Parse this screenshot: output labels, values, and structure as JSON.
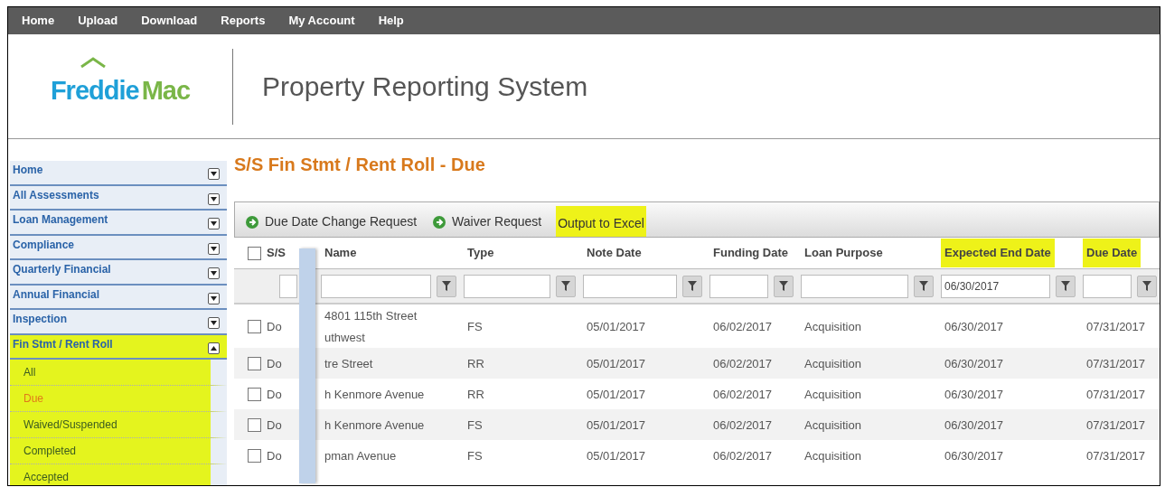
{
  "top_nav": [
    "Home",
    "Upload",
    "Download",
    "Reports",
    "My Account",
    "Help"
  ],
  "logo": {
    "part_1": "Freddie",
    "part_2": "Mac"
  },
  "app_title": "Property Reporting System",
  "sidebar": {
    "items": [
      {
        "label": "Home",
        "expanded": false,
        "highlighted": false
      },
      {
        "label": "All Assessments",
        "expanded": false,
        "highlighted": false
      },
      {
        "label": "Loan Management",
        "expanded": false,
        "highlighted": false
      },
      {
        "label": "Compliance",
        "expanded": false,
        "highlighted": false
      },
      {
        "label": "Quarterly Financial",
        "expanded": false,
        "highlighted": false
      },
      {
        "label": "Annual Financial",
        "expanded": false,
        "highlighted": false
      },
      {
        "label": "Inspection",
        "expanded": false,
        "highlighted": false
      },
      {
        "label": "Fin Stmt / Rent Roll",
        "expanded": true,
        "highlighted": true,
        "children": [
          {
            "label": "All",
            "selected": false
          },
          {
            "label": "Due",
            "selected": true
          },
          {
            "label": "Waived/Suspended",
            "selected": false
          },
          {
            "label": "Completed",
            "selected": false
          },
          {
            "label": "Accepted",
            "selected": false
          }
        ]
      }
    ]
  },
  "page_title": "S/S Fin Stmt / Rent Roll - Due",
  "toolbar": [
    {
      "kind": "action",
      "label": "Due Date Change Request",
      "highlighted": false
    },
    {
      "kind": "action",
      "label": "Waiver Request",
      "highlighted": false
    },
    {
      "kind": "link",
      "label": "Output to Excel",
      "highlighted": true
    }
  ],
  "table": {
    "select_all_checked": false,
    "columns": [
      {
        "label": "S/S",
        "highlighted": false
      },
      {
        "label": "Name",
        "highlighted": false
      },
      {
        "label": "Type",
        "highlighted": false
      },
      {
        "label": "Note Date",
        "highlighted": false
      },
      {
        "label": "Funding Date",
        "highlighted": false
      },
      {
        "label": "Loan Purpose",
        "highlighted": false
      },
      {
        "label": "Expected End Date",
        "highlighted": true,
        "filter_value": "06/30/2017"
      },
      {
        "label": "Due Date",
        "highlighted": true
      }
    ],
    "rows": [
      {
        "checked": false,
        "cells": [
          "Do",
          "4801 115th Street\nuthwest",
          "FS",
          "05/01/2017",
          "06/02/2017",
          "Acquisition",
          "06/30/2017",
          "07/31/2017"
        ]
      },
      {
        "checked": false,
        "cells": [
          "Do",
          "tre Street",
          "RR",
          "05/01/2017",
          "06/02/2017",
          "Acquisition",
          "06/30/2017",
          "07/31/2017"
        ]
      },
      {
        "checked": false,
        "cells": [
          "Do",
          "h Kenmore Avenue",
          "RR",
          "05/01/2017",
          "06/02/2017",
          "Acquisition",
          "06/30/2017",
          "07/31/2017"
        ]
      },
      {
        "checked": false,
        "cells": [
          "Do",
          "h Kenmore Avenue",
          "FS",
          "05/01/2017",
          "06/02/2017",
          "Acquisition",
          "06/30/2017",
          "07/31/2017"
        ]
      },
      {
        "checked": false,
        "cells": [
          "Do",
          "pman Avenue",
          "FS",
          "05/01/2017",
          "06/02/2017",
          "Acquisition",
          "06/30/2017",
          "07/31/2017"
        ]
      }
    ]
  }
}
